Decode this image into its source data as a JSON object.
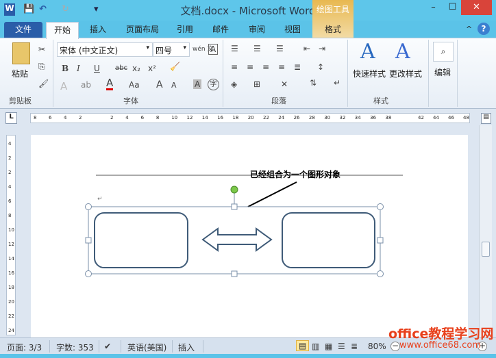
{
  "window": {
    "title": "文档.docx - Microsoft Word",
    "context_tab_group": "绘图工具",
    "minimize": "–",
    "maximize": "☐",
    "close": "✕"
  },
  "qat": {
    "word_icon": "W",
    "save": "💾",
    "undo": "↶",
    "redo": "↻",
    "more": "▾"
  },
  "tabs": [
    {
      "label": "文件"
    },
    {
      "label": "开始"
    },
    {
      "label": "插入"
    },
    {
      "label": "页面布局"
    },
    {
      "label": "引用"
    },
    {
      "label": "邮件"
    },
    {
      "label": "审阅"
    },
    {
      "label": "视图"
    },
    {
      "label": "格式"
    }
  ],
  "ribbon": {
    "clipboard": {
      "paste": "粘贴",
      "group": "剪贴板"
    },
    "font": {
      "name": "宋体 (中文正文)",
      "size": "四号",
      "group": "字体",
      "bold": "B",
      "italic": "I",
      "underline": "U",
      "strike": "abc",
      "sub": "x₂",
      "sup": "x²",
      "color": "A",
      "case": "Aa",
      "grow": "A",
      "shrink": "A",
      "wen": "wén 文",
      "border_a": "A",
      "shade_a": "A",
      "enclose": "字"
    },
    "paragraph": {
      "group": "段落"
    },
    "styles": {
      "quick": "快速样式",
      "change": "更改样式",
      "group": "样式"
    },
    "editing": {
      "label": "编辑"
    },
    "help": "?",
    "collapse": "^"
  },
  "ruler": {
    "left_ticks": [
      "8",
      "6",
      "4",
      "2"
    ],
    "right_ticks": [
      "2",
      "4",
      "6",
      "8",
      "10",
      "12",
      "14",
      "16",
      "18",
      "20",
      "22",
      "24",
      "26",
      "28",
      "30",
      "32",
      "34",
      "36",
      "38"
    ],
    "far_ticks": [
      "42",
      "44",
      "46",
      "48"
    ],
    "vertical_ticks": [
      "4",
      "2",
      "2",
      "4",
      "6",
      "8",
      "10",
      "12",
      "14",
      "16",
      "18",
      "20",
      "22",
      "24"
    ]
  },
  "document": {
    "annotation": "已经组合为一个图形对象",
    "para_mark": "↵"
  },
  "status": {
    "page": "页面: 3/3",
    "words": "字数: 353",
    "language": "英语(美国)",
    "mode": "插入",
    "zoom": "80%"
  },
  "watermark": {
    "title": "office教程学习网",
    "url": "www.office68.com"
  },
  "colors": {
    "title_bar": "#5ec6ea",
    "file_tab": "#2a5da8",
    "shape_stroke": "#3f5b78",
    "handle_green": "#7cc84a",
    "watermark": "#e8401c"
  }
}
